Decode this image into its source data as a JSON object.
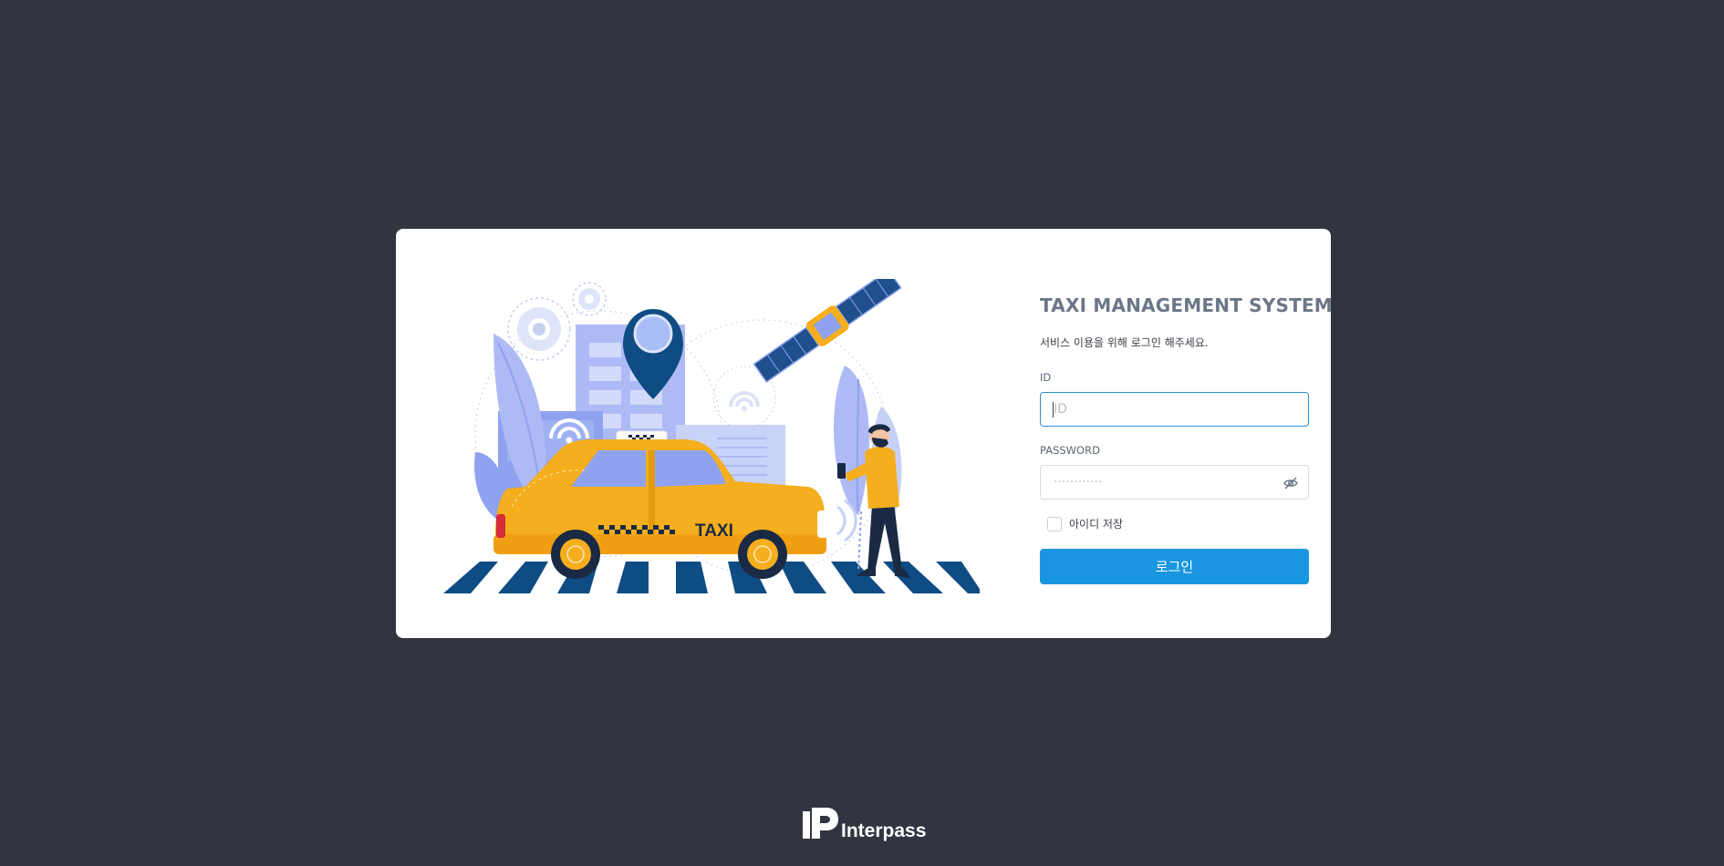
{
  "login": {
    "title": "TAXI MANAGEMENT SYSTEM",
    "subtitle": "서비스 이용을 위해 로그인 해주세요.",
    "id_label": "ID",
    "id_placeholder": "ID",
    "id_value": "",
    "password_label": "PASSWORD",
    "password_placeholder": "············",
    "remember_label": "아이디 저장",
    "remember_checked": false,
    "submit_label": "로그인"
  },
  "illustration": {
    "taxi_sign": "TAXI"
  },
  "footer": {
    "brand_name": "Interpass"
  },
  "colors": {
    "background": "#32353f",
    "card": "#ffffff",
    "primary_button": "#1a96e0",
    "title": "#6b7787",
    "taxi_yellow": "#f5ae1d",
    "illustration_blue": "#8ea2f0",
    "illustration_navy": "#0f4c84"
  },
  "icons": {
    "password_toggle": "eye-off-icon",
    "footer_logo": "interpass-logo-icon"
  }
}
